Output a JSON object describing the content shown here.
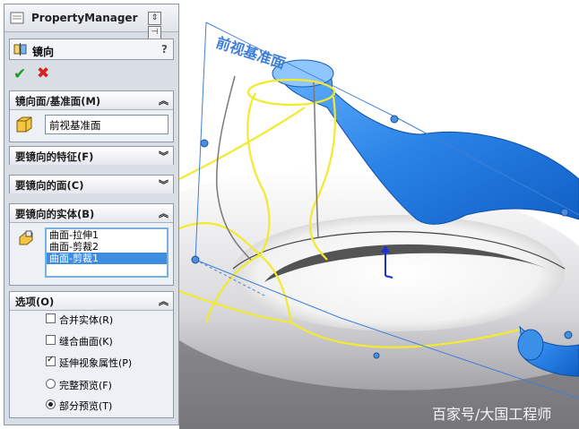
{
  "panel": {
    "title": "PropertyManager",
    "feature_name": "镜向",
    "help": "?",
    "ok_glyph": "✔",
    "cancel_glyph": "✖"
  },
  "mirror_face": {
    "header": "镜向面/基准面(M)",
    "value": "前视基准面"
  },
  "features_to_mirror": {
    "header": "要镜向的特征(F)"
  },
  "faces_to_mirror": {
    "header": "要镜向的面(C)"
  },
  "bodies_to_mirror": {
    "header": "要镜向的实体(B)",
    "items": [
      "曲面-拉伸1",
      "曲面-剪裁2",
      "曲面-剪裁1"
    ],
    "selected_index": 2
  },
  "options": {
    "header": "选项(O)",
    "merge": {
      "label": "合并实体(R)",
      "checked": false
    },
    "knit": {
      "label": "缝合曲面(K)",
      "checked": false
    },
    "propagate": {
      "label": "延伸视象属性(P)",
      "checked": true
    },
    "full_preview": {
      "label": "完整预览(F)",
      "selected": false
    },
    "partial_preview": {
      "label": "部分预览(T)",
      "selected": true
    }
  },
  "viewport": {
    "plane_label": "前视基准面",
    "surface_color": "#2f86e8",
    "wire_color": "#f5ef3a"
  },
  "watermark": "百家号/大国工程师"
}
